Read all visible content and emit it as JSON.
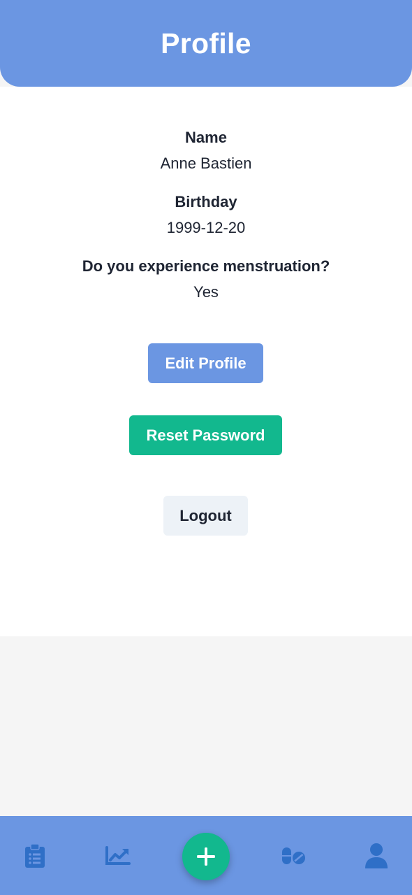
{
  "header": {
    "title": "Profile"
  },
  "profile": {
    "name_label": "Name",
    "name_value": "Anne Bastien",
    "birthday_label": "Birthday",
    "birthday_value": "1999-12-20",
    "menstruation_label": "Do you experience menstruation?",
    "menstruation_value": "Yes"
  },
  "actions": {
    "edit_label": "Edit Profile",
    "reset_label": "Reset Password",
    "logout_label": "Logout"
  },
  "bottom_nav": {
    "items": [
      {
        "icon": "clipboard-list-icon"
      },
      {
        "icon": "chart-line-icon"
      },
      {
        "icon": "plus-icon"
      },
      {
        "icon": "pills-icon"
      },
      {
        "icon": "user-icon"
      }
    ]
  },
  "colors": {
    "primary": "#6b96e2",
    "accent": "#12b88e",
    "icon": "#2f6fc7",
    "secondary_button": "#edf2f7",
    "background": "#f5f5f5"
  }
}
